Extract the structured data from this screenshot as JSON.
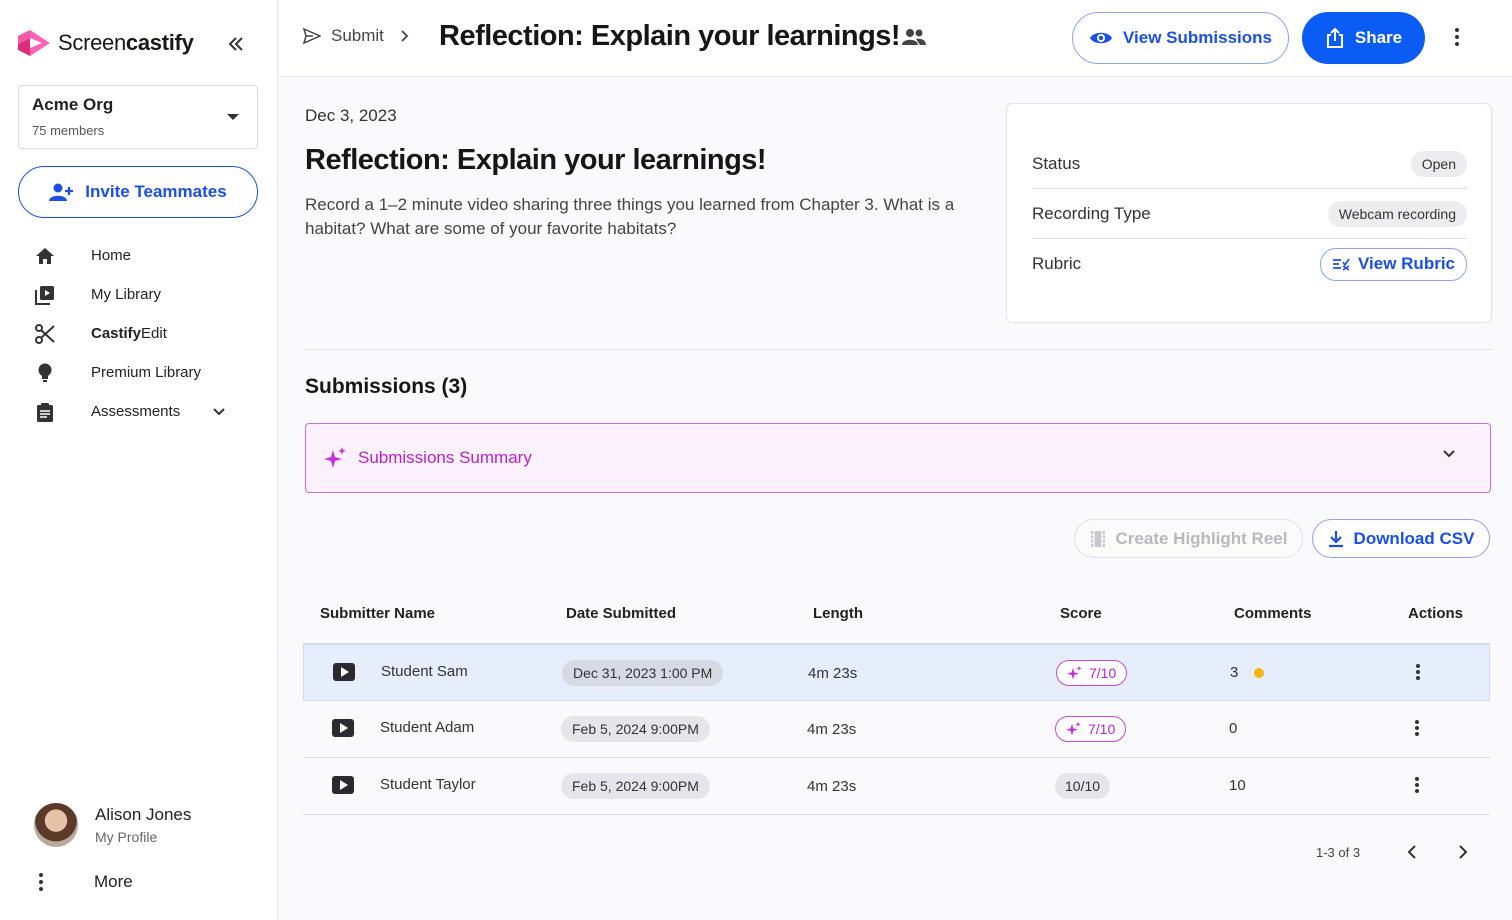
{
  "brand": {
    "name_regular": "Screen",
    "name_bold": "castify",
    "accent": "#1a4fe8",
    "ai_accent": "#bc1fd2"
  },
  "sidebar": {
    "org": {
      "name": "Acme Org",
      "members": "75 members"
    },
    "invite_label": "Invite Teammates",
    "items": [
      {
        "label": "Home",
        "icon": "home-icon"
      },
      {
        "label": "My Library",
        "icon": "library-icon"
      },
      {
        "label_bold": "Castify",
        "label_rest": "Edit",
        "icon": "scissors-icon"
      },
      {
        "label": "Premium Library",
        "icon": "lightbulb-icon"
      },
      {
        "label": "Assessments",
        "icon": "clipboard-icon"
      }
    ],
    "profile": {
      "name": "Alison Jones",
      "sub": "My Profile"
    },
    "more_label": "More"
  },
  "header": {
    "crumb": "Submit",
    "title": "Reflection: Explain your learnings!",
    "view_submissions": "View Submissions",
    "share": "Share"
  },
  "assignment": {
    "date": "Dec 3, 2023",
    "title": "Reflection: Explain your learnings!",
    "description": "Record a 1–2 minute video sharing three things you learned from Chapter 3. What is a habitat? What are some of your favorite habitats?"
  },
  "info": {
    "status_label": "Status",
    "status_value": "Open",
    "recording_label": "Recording Type",
    "recording_value": "Webcam recording",
    "rubric_label": "Rubric",
    "rubric_button": "View Rubric"
  },
  "submissions": {
    "title": "Submissions (3)",
    "summary_label": "Submissions Summary",
    "highlight_button": "Create Highlight Reel",
    "csv_button": "Download CSV",
    "columns": [
      "Submitter Name",
      "Date Submitted",
      "Length",
      "Score",
      "Comments",
      "Actions"
    ],
    "rows": [
      {
        "name": "Student Sam",
        "date": "Dec 31, 2023 1:00 PM",
        "length": "4m 23s",
        "score": "7/10",
        "ai_score": true,
        "comments": "3",
        "unread": true,
        "selected": true
      },
      {
        "name": "Student Adam",
        "date": "Feb 5, 2024 9:00PM",
        "length": "4m 23s",
        "score": "7/10",
        "ai_score": true,
        "comments": "0",
        "unread": false,
        "selected": false
      },
      {
        "name": "Student Taylor",
        "date": "Feb 5, 2024 9:00PM",
        "length": "4m 23s",
        "score": "10/10",
        "ai_score": false,
        "comments": "10",
        "unread": false,
        "selected": false
      }
    ],
    "pager": "1-3 of 3"
  }
}
